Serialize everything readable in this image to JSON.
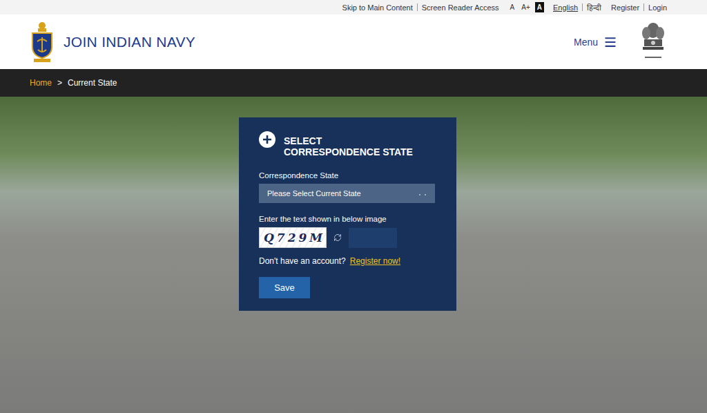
{
  "top_bar": {
    "links": [
      "Skip to Main Content",
      "Screen Reader Access"
    ],
    "font_sizes": [
      {
        "label": "A",
        "selected": false
      },
      {
        "label": "A+",
        "selected": false
      },
      {
        "label": "A",
        "selected": true
      }
    ],
    "languages": [
      {
        "label": "English",
        "selected": true
      },
      {
        "label": "हिन्दी",
        "selected": false
      }
    ],
    "account": [
      "Register",
      "Login"
    ]
  },
  "header": {
    "title": "JOIN INDIAN NAVY",
    "menu": "Menu"
  },
  "breadcrumb": {
    "separator": ">",
    "items": [
      {
        "label": "Home",
        "current": false
      },
      {
        "label": "Current State",
        "current": true
      }
    ]
  },
  "form": {
    "title_lines": [
      "SELECT",
      "CORRESPONDENCE STATE"
    ],
    "field_label": "Correspondence State",
    "select_placeholder": "Please Select Current State",
    "captcha_label": "Enter the text shown in below image",
    "captcha": "Q729M",
    "captcha_input": "",
    "register_prompt": "Don't have an account?",
    "register_link": "Register now!",
    "button": "Save"
  }
}
